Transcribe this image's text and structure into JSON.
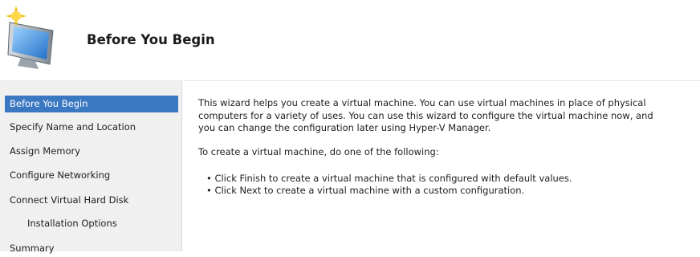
{
  "header": {
    "title": "Before You Begin",
    "icon": "wizard-monitor-icon"
  },
  "sidebar": {
    "items": [
      {
        "label": "Before You Begin",
        "active": true
      },
      {
        "label": "Specify Name and Location"
      },
      {
        "label": "Assign Memory"
      },
      {
        "label": "Configure Networking"
      },
      {
        "label": "Connect Virtual Hard Disk"
      },
      {
        "label": "Installation Options",
        "sub": true
      },
      {
        "label": "Summary"
      }
    ]
  },
  "content": {
    "intro_lines": [
      "This wizard helps you create a virtual machine. You can use virtual machines in place of physical",
      "computers for a variety of uses. You can use this wizard to configure the virtual machine now, and",
      "you can change the configuration later using Hyper-V Manager."
    ],
    "instruction": "To create a virtual machine, do one of the following:",
    "bullets": [
      "Click Finish to create a virtual machine that is configured with default values.",
      "Click Next to create a virtual machine with a custom configuration."
    ]
  },
  "colors": {
    "selection": "#3a78c2",
    "sidebar_bg": "#f0f0f0",
    "content_bg": "#ffffff"
  }
}
